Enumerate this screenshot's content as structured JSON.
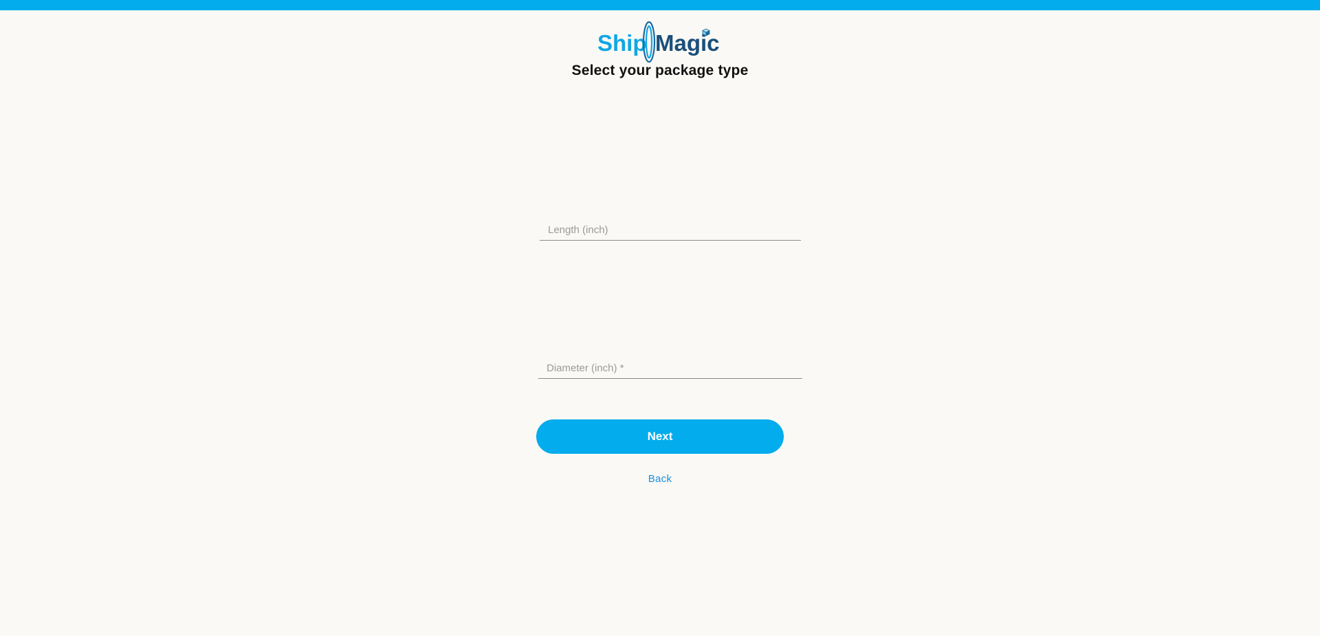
{
  "brand": {
    "logo_text_part1": "Ship",
    "logo_text_part2": "Magic",
    "colors": {
      "accent": "#03acec",
      "logo_dark": "#1b4f7a",
      "logo_light": "#10a6e5",
      "link": "#1a8fdb",
      "background": "#faf9f5"
    }
  },
  "header": {
    "title": "Select your package type"
  },
  "form": {
    "length_placeholder": "Length (inch)",
    "length_value": "",
    "diameter_placeholder": "Diameter (inch) *",
    "diameter_value": ""
  },
  "actions": {
    "next_label": "Next",
    "back_label": "Back"
  },
  "icons": {
    "logo": "shipmagic-logo-portal-icon",
    "cube": "cube-icon"
  }
}
